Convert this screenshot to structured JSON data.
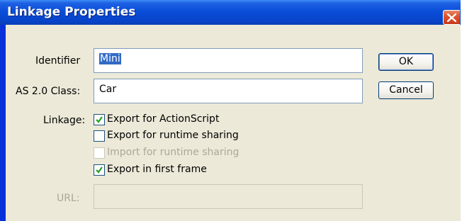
{
  "window": {
    "title": "Linkage Properties"
  },
  "identifier": {
    "label": "Identifier",
    "value": "Mini"
  },
  "as_class": {
    "label": "AS 2.0 Class:",
    "value": "Car"
  },
  "linkage": {
    "label": "Linkage:",
    "options": [
      {
        "label": "Export for ActionScript",
        "checked": true,
        "enabled": true
      },
      {
        "label": "Export for runtime sharing",
        "checked": false,
        "enabled": true
      },
      {
        "label": "Import for runtime sharing",
        "checked": false,
        "enabled": false
      },
      {
        "label": "Export in first frame",
        "checked": true,
        "enabled": true
      }
    ]
  },
  "url": {
    "label": "URL:",
    "value": ""
  },
  "buttons": {
    "ok": "OK",
    "cancel": "Cancel"
  },
  "colors": {
    "title_bar": "#0a4ed8",
    "dialog_bg": "#ece9d8",
    "close_button": "#e0552f",
    "selection": "#316ac5"
  }
}
